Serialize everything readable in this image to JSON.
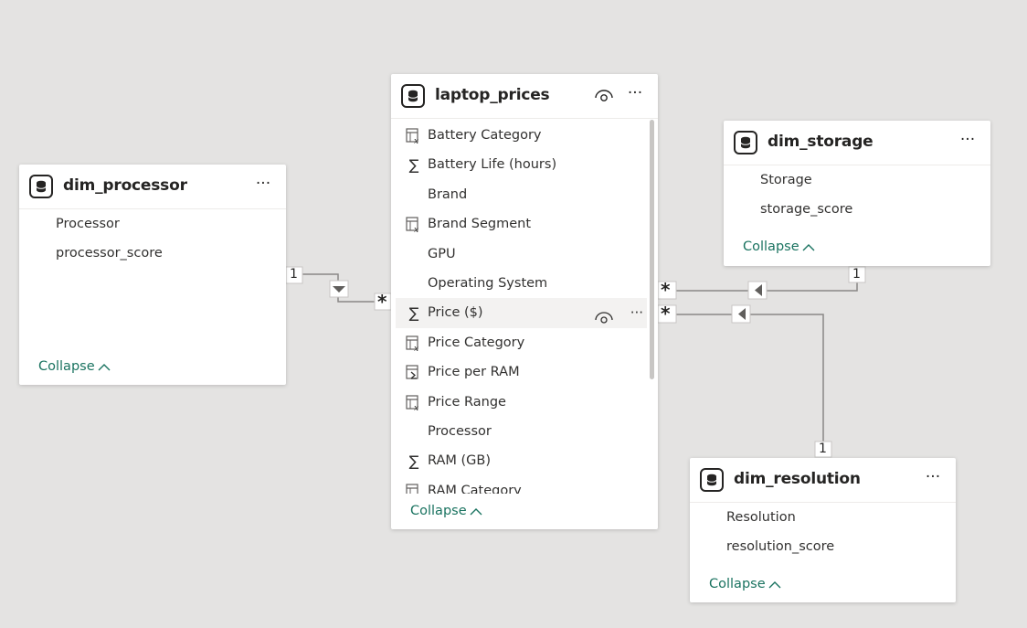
{
  "tables": {
    "laptop_prices": {
      "title": "laptop_prices",
      "fields": [
        {
          "label": "Battery Category",
          "icon": "calculated-column-icon"
        },
        {
          "label": "Battery Life (hours)",
          "icon": "sigma-icon"
        },
        {
          "label": "Brand",
          "icon": ""
        },
        {
          "label": "Brand Segment",
          "icon": "calculated-column-icon"
        },
        {
          "label": "GPU",
          "icon": ""
        },
        {
          "label": "Operating System",
          "icon": ""
        },
        {
          "label": "Price ($)",
          "icon": "sigma-icon"
        },
        {
          "label": "Price Category",
          "icon": "calculated-column-icon"
        },
        {
          "label": "Price per RAM",
          "icon": "measure-icon"
        },
        {
          "label": "Price Range",
          "icon": "calculated-column-icon"
        },
        {
          "label": "Processor",
          "icon": ""
        },
        {
          "label": "RAM (GB)",
          "icon": "sigma-icon"
        },
        {
          "label": "RAM Category",
          "icon": "calculated-column-icon"
        }
      ],
      "collapse_label": "Collapse"
    },
    "dim_processor": {
      "title": "dim_processor",
      "fields": [
        {
          "label": "Processor"
        },
        {
          "label": "processor_score"
        }
      ],
      "collapse_label": "Collapse"
    },
    "dim_storage": {
      "title": "dim_storage",
      "fields": [
        {
          "label": "Storage"
        },
        {
          "label": "storage_score"
        }
      ],
      "collapse_label": "Collapse"
    },
    "dim_resolution": {
      "title": "dim_resolution",
      "fields": [
        {
          "label": "Resolution"
        },
        {
          "label": "resolution_score"
        }
      ],
      "collapse_label": "Collapse"
    }
  },
  "relationships": {
    "processor": {
      "one": "1",
      "many": "*"
    },
    "storage": {
      "one": "1",
      "many": "*"
    },
    "resolution": {
      "one": "1",
      "many": "*"
    }
  },
  "colors": {
    "accent": "#1a7360",
    "background": "#e4e3e2",
    "line": "#8a8886"
  },
  "more_glyph": "···"
}
